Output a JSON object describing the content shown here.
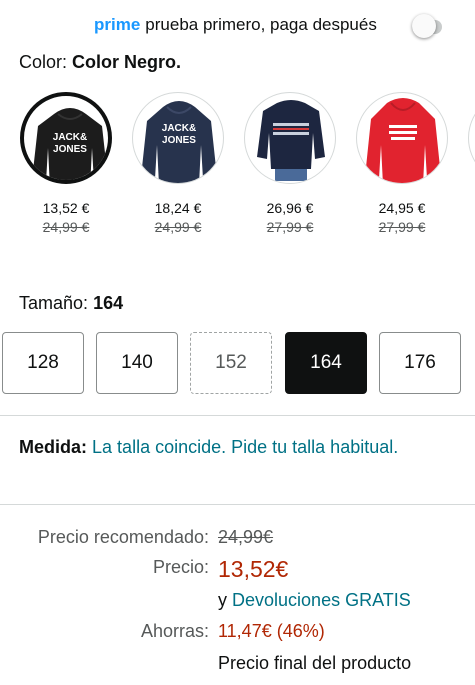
{
  "prime": {
    "brand": "prime",
    "text": "prueba primero, paga después",
    "toggle_on": false
  },
  "color": {
    "label": "Color:",
    "value": "Color Negro."
  },
  "swatches": [
    {
      "name": "black",
      "price": "13,52 €",
      "old_price": "24,99 €",
      "selected": true,
      "color": "#1c1c1c",
      "logo": "JACK & JONES"
    },
    {
      "name": "navy",
      "price": "18,24 €",
      "old_price": "24,99 €",
      "selected": false,
      "color": "#27334d",
      "logo": "JACK & JONES"
    },
    {
      "name": "navy-stripe",
      "price": "26,96 €",
      "old_price": "27,99 €",
      "selected": false,
      "color": "#1d2640"
    },
    {
      "name": "red",
      "price": "24,95 €",
      "old_price": "27,99 €",
      "selected": false,
      "color": "#e1232f"
    }
  ],
  "size": {
    "label": "Tamaño:",
    "value": "164",
    "options": [
      {
        "label": "128",
        "state": "available"
      },
      {
        "label": "140",
        "state": "available"
      },
      {
        "label": "152",
        "state": "unavailable"
      },
      {
        "label": "164",
        "state": "selected"
      },
      {
        "label": "176",
        "state": "available"
      }
    ]
  },
  "fit": {
    "label": "Medida:",
    "text": "La talla coincide. Pide tu talla habitual."
  },
  "pricing": {
    "recommended_label": "Precio recomendado:",
    "recommended_value": "24,99€",
    "price_label": "Precio:",
    "price_value": "13,52€",
    "returns_prefix": "y",
    "returns_link": "Devoluciones GRATIS",
    "savings_label": "Ahorras:",
    "savings_value": "11,47€ (46%)",
    "final_note": "Precio final del producto"
  },
  "colors": {
    "link": "#007185",
    "price": "#b12704",
    "prime": "#1a98ff",
    "selected_size": "#0f1111"
  }
}
